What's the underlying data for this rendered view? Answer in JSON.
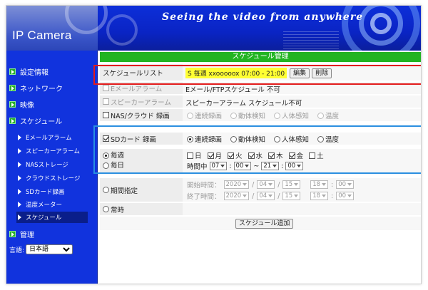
{
  "banner": {
    "title": "IP Camera",
    "slogan": "Seeing the video from anywhere"
  },
  "sidebar": {
    "items": [
      {
        "label": "設定情報"
      },
      {
        "label": "ネットワーク"
      },
      {
        "label": "映像"
      },
      {
        "label": "スケジュール"
      }
    ],
    "sub_items": [
      {
        "label": "Eメールアラーム"
      },
      {
        "label": "スピーカーアラーム"
      },
      {
        "label": "NASストレージ"
      },
      {
        "label": "クラウドストレージ"
      },
      {
        "label": "SDカード録画"
      },
      {
        "label": "温度メーター"
      },
      {
        "label": "スケジュール"
      }
    ],
    "manage": "管理",
    "language_label": "言語:",
    "language_value": "日本語"
  },
  "main": {
    "header": "スケジュール管理",
    "schedule_list_label": "スケジュールリスト",
    "schedule_list_value": "S 毎週 xxooooox 07:00 - 21:00",
    "edit_button": "編集",
    "delete_button": "削除",
    "email_alarm_label": "Eメールアラーム",
    "email_alarm_value": "Eメール/FTPスケジュール 不可",
    "speaker_alarm_label": "スピーカーアラーム",
    "speaker_alarm_value": "スピーカーアラーム スケジュール不可",
    "nas_label": "NAS/クラウド 録画",
    "sd_label": "SDカード 録画",
    "modes": [
      "連続録画",
      "動体検知",
      "人体感知",
      "温度"
    ],
    "weekly": "毎週",
    "daily": "毎日",
    "days": [
      {
        "label": "日",
        "checked": false
      },
      {
        "label": "月",
        "checked": true
      },
      {
        "label": "火",
        "checked": true
      },
      {
        "label": "水",
        "checked": true
      },
      {
        "label": "木",
        "checked": true
      },
      {
        "label": "金",
        "checked": true
      },
      {
        "label": "土",
        "checked": false
      }
    ],
    "time_label": "時間中",
    "time_start_h": "07",
    "time_start_m": "00",
    "time_sep": "~",
    "time_end_h": "21",
    "time_end_m": "00",
    "period_label": "期間指定",
    "start_label": "開始時間：",
    "end_label": "終了時間：",
    "year": "2020",
    "month": "04",
    "day": "15",
    "hour": "18",
    "minute": "00",
    "always_label": "常時",
    "add_button": "スケジュール追加"
  },
  "colors": {
    "sidebar_bg": "#1133dd",
    "header_green": "#22b422",
    "highlight_yellow": "#ffff33",
    "red_outline": "#e31b1b",
    "blue_outline": "#2b8fe0"
  }
}
